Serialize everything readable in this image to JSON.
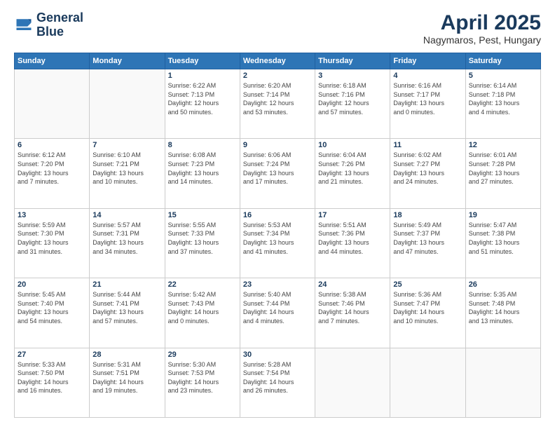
{
  "logo": {
    "line1": "General",
    "line2": "Blue"
  },
  "header": {
    "month": "April 2025",
    "location": "Nagymaros, Pest, Hungary"
  },
  "weekdays": [
    "Sunday",
    "Monday",
    "Tuesday",
    "Wednesday",
    "Thursday",
    "Friday",
    "Saturday"
  ],
  "days": [
    {
      "date": "",
      "info": ""
    },
    {
      "date": "",
      "info": ""
    },
    {
      "date": "1",
      "info": "Sunrise: 6:22 AM\nSunset: 7:13 PM\nDaylight: 12 hours\nand 50 minutes."
    },
    {
      "date": "2",
      "info": "Sunrise: 6:20 AM\nSunset: 7:14 PM\nDaylight: 12 hours\nand 53 minutes."
    },
    {
      "date": "3",
      "info": "Sunrise: 6:18 AM\nSunset: 7:16 PM\nDaylight: 12 hours\nand 57 minutes."
    },
    {
      "date": "4",
      "info": "Sunrise: 6:16 AM\nSunset: 7:17 PM\nDaylight: 13 hours\nand 0 minutes."
    },
    {
      "date": "5",
      "info": "Sunrise: 6:14 AM\nSunset: 7:18 PM\nDaylight: 13 hours\nand 4 minutes."
    },
    {
      "date": "6",
      "info": "Sunrise: 6:12 AM\nSunset: 7:20 PM\nDaylight: 13 hours\nand 7 minutes."
    },
    {
      "date": "7",
      "info": "Sunrise: 6:10 AM\nSunset: 7:21 PM\nDaylight: 13 hours\nand 10 minutes."
    },
    {
      "date": "8",
      "info": "Sunrise: 6:08 AM\nSunset: 7:23 PM\nDaylight: 13 hours\nand 14 minutes."
    },
    {
      "date": "9",
      "info": "Sunrise: 6:06 AM\nSunset: 7:24 PM\nDaylight: 13 hours\nand 17 minutes."
    },
    {
      "date": "10",
      "info": "Sunrise: 6:04 AM\nSunset: 7:26 PM\nDaylight: 13 hours\nand 21 minutes."
    },
    {
      "date": "11",
      "info": "Sunrise: 6:02 AM\nSunset: 7:27 PM\nDaylight: 13 hours\nand 24 minutes."
    },
    {
      "date": "12",
      "info": "Sunrise: 6:01 AM\nSunset: 7:28 PM\nDaylight: 13 hours\nand 27 minutes."
    },
    {
      "date": "13",
      "info": "Sunrise: 5:59 AM\nSunset: 7:30 PM\nDaylight: 13 hours\nand 31 minutes."
    },
    {
      "date": "14",
      "info": "Sunrise: 5:57 AM\nSunset: 7:31 PM\nDaylight: 13 hours\nand 34 minutes."
    },
    {
      "date": "15",
      "info": "Sunrise: 5:55 AM\nSunset: 7:33 PM\nDaylight: 13 hours\nand 37 minutes."
    },
    {
      "date": "16",
      "info": "Sunrise: 5:53 AM\nSunset: 7:34 PM\nDaylight: 13 hours\nand 41 minutes."
    },
    {
      "date": "17",
      "info": "Sunrise: 5:51 AM\nSunset: 7:36 PM\nDaylight: 13 hours\nand 44 minutes."
    },
    {
      "date": "18",
      "info": "Sunrise: 5:49 AM\nSunset: 7:37 PM\nDaylight: 13 hours\nand 47 minutes."
    },
    {
      "date": "19",
      "info": "Sunrise: 5:47 AM\nSunset: 7:38 PM\nDaylight: 13 hours\nand 51 minutes."
    },
    {
      "date": "20",
      "info": "Sunrise: 5:45 AM\nSunset: 7:40 PM\nDaylight: 13 hours\nand 54 minutes."
    },
    {
      "date": "21",
      "info": "Sunrise: 5:44 AM\nSunset: 7:41 PM\nDaylight: 13 hours\nand 57 minutes."
    },
    {
      "date": "22",
      "info": "Sunrise: 5:42 AM\nSunset: 7:43 PM\nDaylight: 14 hours\nand 0 minutes."
    },
    {
      "date": "23",
      "info": "Sunrise: 5:40 AM\nSunset: 7:44 PM\nDaylight: 14 hours\nand 4 minutes."
    },
    {
      "date": "24",
      "info": "Sunrise: 5:38 AM\nSunset: 7:46 PM\nDaylight: 14 hours\nand 7 minutes."
    },
    {
      "date": "25",
      "info": "Sunrise: 5:36 AM\nSunset: 7:47 PM\nDaylight: 14 hours\nand 10 minutes."
    },
    {
      "date": "26",
      "info": "Sunrise: 5:35 AM\nSunset: 7:48 PM\nDaylight: 14 hours\nand 13 minutes."
    },
    {
      "date": "27",
      "info": "Sunrise: 5:33 AM\nSunset: 7:50 PM\nDaylight: 14 hours\nand 16 minutes."
    },
    {
      "date": "28",
      "info": "Sunrise: 5:31 AM\nSunset: 7:51 PM\nDaylight: 14 hours\nand 19 minutes."
    },
    {
      "date": "29",
      "info": "Sunrise: 5:30 AM\nSunset: 7:53 PM\nDaylight: 14 hours\nand 23 minutes."
    },
    {
      "date": "30",
      "info": "Sunrise: 5:28 AM\nSunset: 7:54 PM\nDaylight: 14 hours\nand 26 minutes."
    },
    {
      "date": "",
      "info": ""
    },
    {
      "date": "",
      "info": ""
    },
    {
      "date": "",
      "info": ""
    }
  ]
}
